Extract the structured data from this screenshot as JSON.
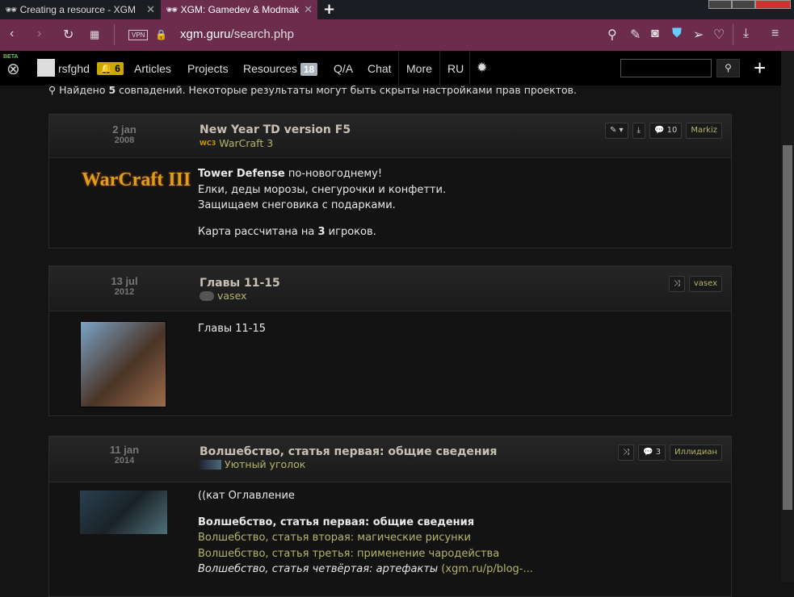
{
  "browser": {
    "tabs": [
      {
        "title": "Creating a resource - XGM"
      },
      {
        "title": "XGM: Gamedev & Modmak"
      }
    ],
    "url_host": "xgm.guru",
    "url_path": "/search.php",
    "vpn": "VPN"
  },
  "nav": {
    "beta": "BETA",
    "user": "rsfghd",
    "notifications": "6",
    "items": [
      "Articles",
      "Projects",
      "Resources",
      "Q/A",
      "Chat",
      "More",
      "RU"
    ],
    "resources_count": "18",
    "search_placeholder": ""
  },
  "search": {
    "summary_pre": "Найдено ",
    "count": "5",
    "summary_post": " совпадений. Некоторые результаты могут быть скрыты настройками прав проектов."
  },
  "results": [
    {
      "day": "2 jan",
      "year": "2008",
      "title": "New Year TD version F5",
      "project": "WarCraft 3",
      "comments": "10",
      "author": "Markiz",
      "logo": "WarCraft III",
      "lines": {
        "b": "Tower Defense",
        "l1": " по-новогоднему!",
        "l2": "Елки, деды морозы, снегурочки и конфетти.",
        "l3": "Защищаем снеговика с подарками.",
        "l4a": "Карта рассчитана на ",
        "l4b": "3",
        "l4c": " игроков."
      }
    },
    {
      "day": "13 jul",
      "year": "2012",
      "title": "Главы 11-15",
      "project": "vasex",
      "author": "vasex",
      "text": "Главы 11-15"
    },
    {
      "day": "11 jan",
      "year": "2014",
      "title": "Волшебство, статья первая: общие сведения",
      "project": "Уютный уголок",
      "comments": "3",
      "author": "Иллидиан",
      "lines": {
        "l1": "((кат Оглавление",
        "l2": "Волшебство, статья первая: общие сведения",
        "l3": "Волшебство, статья вторая: магические рисунки",
        "l4": "Волшебство, статья третья: применение чародейства",
        "l5": "Волшебство, статья четвёртая: артефакты",
        "l5b": " (xgm.ru/p/blog-..."
      }
    }
  ]
}
